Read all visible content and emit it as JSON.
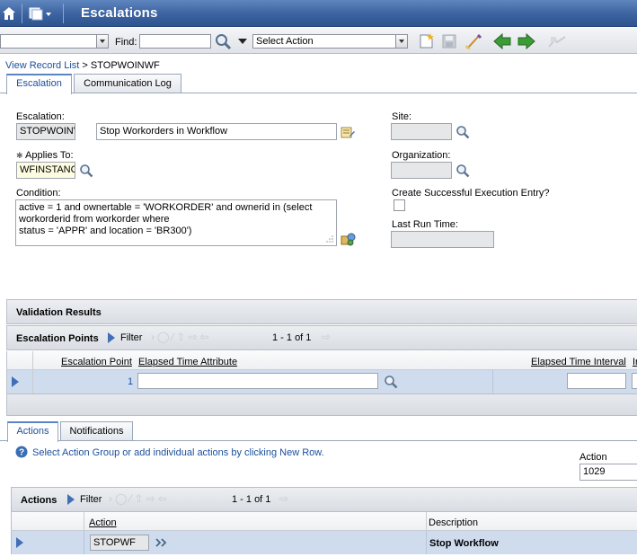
{
  "app": {
    "title": "Escalations"
  },
  "toolbar": {
    "find_label": "Find:",
    "find_value": "",
    "select_action": "Select Action"
  },
  "breadcrumb": {
    "list_link": "View Record List",
    "separator": ">",
    "record": "STOPWOINWF"
  },
  "tabs": [
    {
      "label": "Escalation",
      "active": true
    },
    {
      "label": "Communication Log",
      "active": false
    }
  ],
  "form": {
    "escalation_label": "Escalation:",
    "escalation_value": "STOPWOINV",
    "escalation_desc": "Stop Workorders in Workflow",
    "applies_to_label": "Applies To:",
    "applies_to_value": "WFINSTANC",
    "condition_label": "Condition:",
    "condition_lines": [
      "active = 1 and ownertable = 'WORKORDER' and ownerid in (select",
      "workorderid from workorder where",
      "status = 'APPR' and location = 'BR300')"
    ],
    "site_label": "Site:",
    "site_value": "",
    "org_label": "Organization:",
    "org_value": "",
    "create_entry_label": "Create Successful Execution Entry?",
    "create_entry_checked": false,
    "last_run_label": "Last Run Time:",
    "last_run_value": ""
  },
  "validation": {
    "title": "Validation Results"
  },
  "esc_points": {
    "title": "Escalation Points",
    "filter_label": "Filter",
    "pager": "1 - 1 of 1",
    "columns": [
      "Escalation Point",
      "Elapsed Time Attribute",
      "Elapsed Time Interval",
      "In"
    ],
    "rows": [
      {
        "point": "1",
        "attribute": "",
        "interval": ""
      }
    ]
  },
  "sub_tabs": [
    {
      "label": "Actions",
      "active": true
    },
    {
      "label": "Notifications",
      "active": false
    }
  ],
  "actions": {
    "help_text": "Select Action Group or add individual actions by clicking New Row.",
    "group_label": "Action Group:",
    "group_value": "1029",
    "title": "Actions",
    "filter_label": "Filter",
    "pager": "1 - 1 of 1",
    "columns": [
      "Action",
      "Description"
    ],
    "rows": [
      {
        "action": "STOPWF",
        "description": "Stop Workflow"
      }
    ]
  },
  "colors": {
    "title_bar": "#3c629f",
    "link": "#1a4f9c",
    "selected_row": "#cfdcee"
  }
}
